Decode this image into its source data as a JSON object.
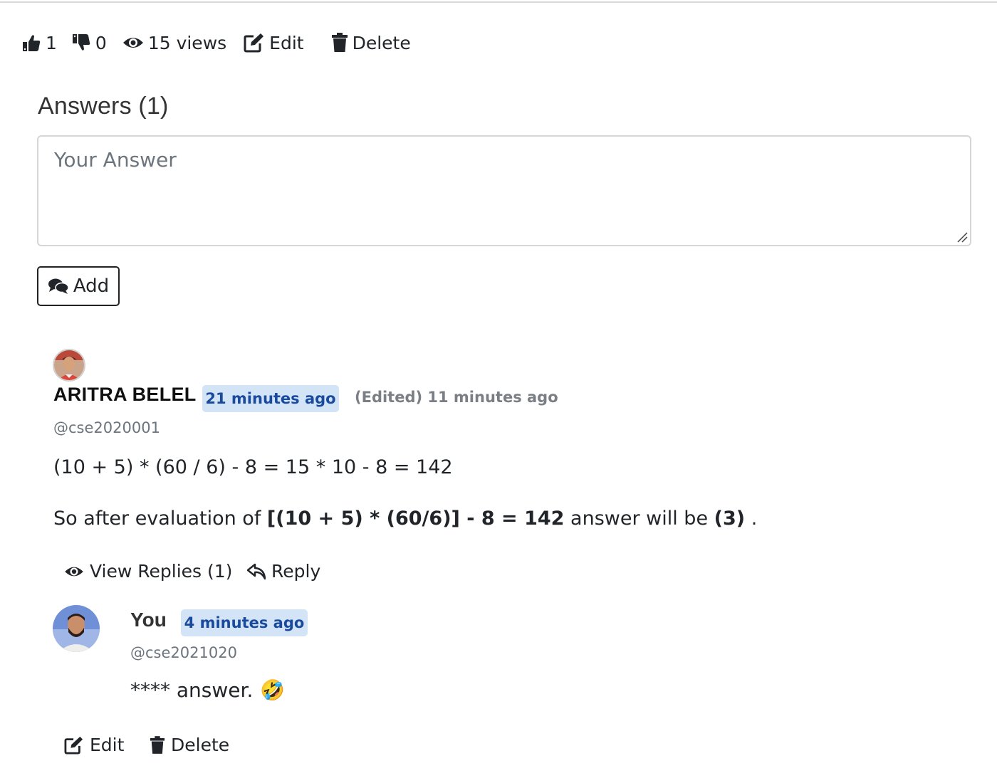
{
  "stats": {
    "likes": "1",
    "dislikes": "0",
    "views": "15 views",
    "edit_label": "Edit",
    "delete_label": "Delete"
  },
  "answers": {
    "title": "Answers (1)",
    "input_placeholder": "Your Answer",
    "add_label": "Add"
  },
  "answer": {
    "author": "ARITRA BELEL",
    "time": "21 minutes ago",
    "edited": "(Edited) 11 minutes ago",
    "handle": "@cse2020001",
    "line1": "(10 + 5) * (60 / 6) - 8 = 15 * 10 - 8 = 142",
    "line2_prefix": "So after evaluation of ",
    "line2_bold1": "[(10 + 5) * (60/6)] - 8 = 142",
    "line2_middle": " answer will be ",
    "line2_bold2": "(3)",
    "line2_suffix": " .",
    "view_replies_label": "View Replies (1)",
    "reply_label": "Reply"
  },
  "reply": {
    "author": "You",
    "time": "4 minutes ago",
    "handle": "@cse2021020",
    "text": "**** answer.",
    "emoji": "🤣",
    "edit_label": "Edit",
    "delete_label": "Delete"
  },
  "colors": {
    "badge_bg": "#d4e4f7",
    "badge_text": "#1a4a9e",
    "muted": "#6c757d"
  }
}
